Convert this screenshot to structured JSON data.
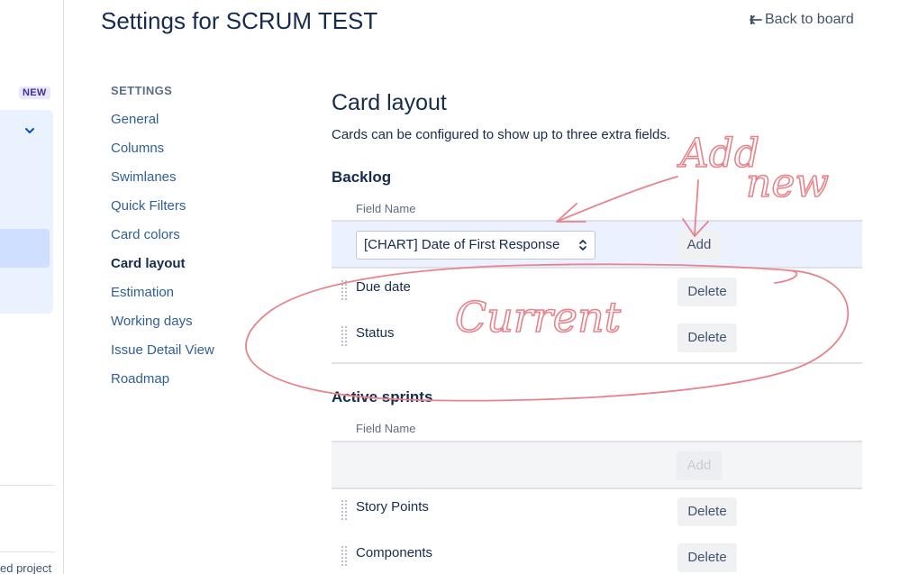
{
  "page": {
    "title": "Settings for SCRUM TEST",
    "back_link": "Back to board"
  },
  "left_sidebar": {
    "new_badge": "NEW",
    "footer_text": "ed project"
  },
  "settings_nav": {
    "heading": "SETTINGS",
    "items": [
      {
        "label": "General"
      },
      {
        "label": "Columns"
      },
      {
        "label": "Swimlanes"
      },
      {
        "label": "Quick Filters"
      },
      {
        "label": "Card colors"
      },
      {
        "label": "Card layout"
      },
      {
        "label": "Estimation"
      },
      {
        "label": "Working days"
      },
      {
        "label": "Issue Detail View"
      },
      {
        "label": "Roadmap"
      }
    ],
    "active_item": "Card layout"
  },
  "card_layout": {
    "title": "Card layout",
    "description": "Cards can be configured to show up to three extra fields.",
    "backlog": {
      "heading": "Backlog",
      "column_header": "Field Name",
      "select_value": "[CHART] Date of First Response",
      "add_label": "Add",
      "fields": [
        {
          "name": "Due date",
          "delete_label": "Delete"
        },
        {
          "name": "Status",
          "delete_label": "Delete"
        }
      ]
    },
    "active_sprints": {
      "heading": "Active sprints",
      "column_header": "Field Name",
      "add_label": "Add",
      "add_disabled": true,
      "fields": [
        {
          "name": "Story Points",
          "delete_label": "Delete"
        },
        {
          "name": "Components",
          "delete_label": "Delete"
        }
      ]
    }
  },
  "annotations": {
    "handwritten": [
      "Add",
      "new",
      "Current"
    ],
    "color": "#e8838c"
  },
  "colors": {
    "link": "#2e5f99",
    "text": "#172b4d",
    "add_row_bg": "#ebf1ff",
    "badge_bg": "#eae6ff"
  }
}
